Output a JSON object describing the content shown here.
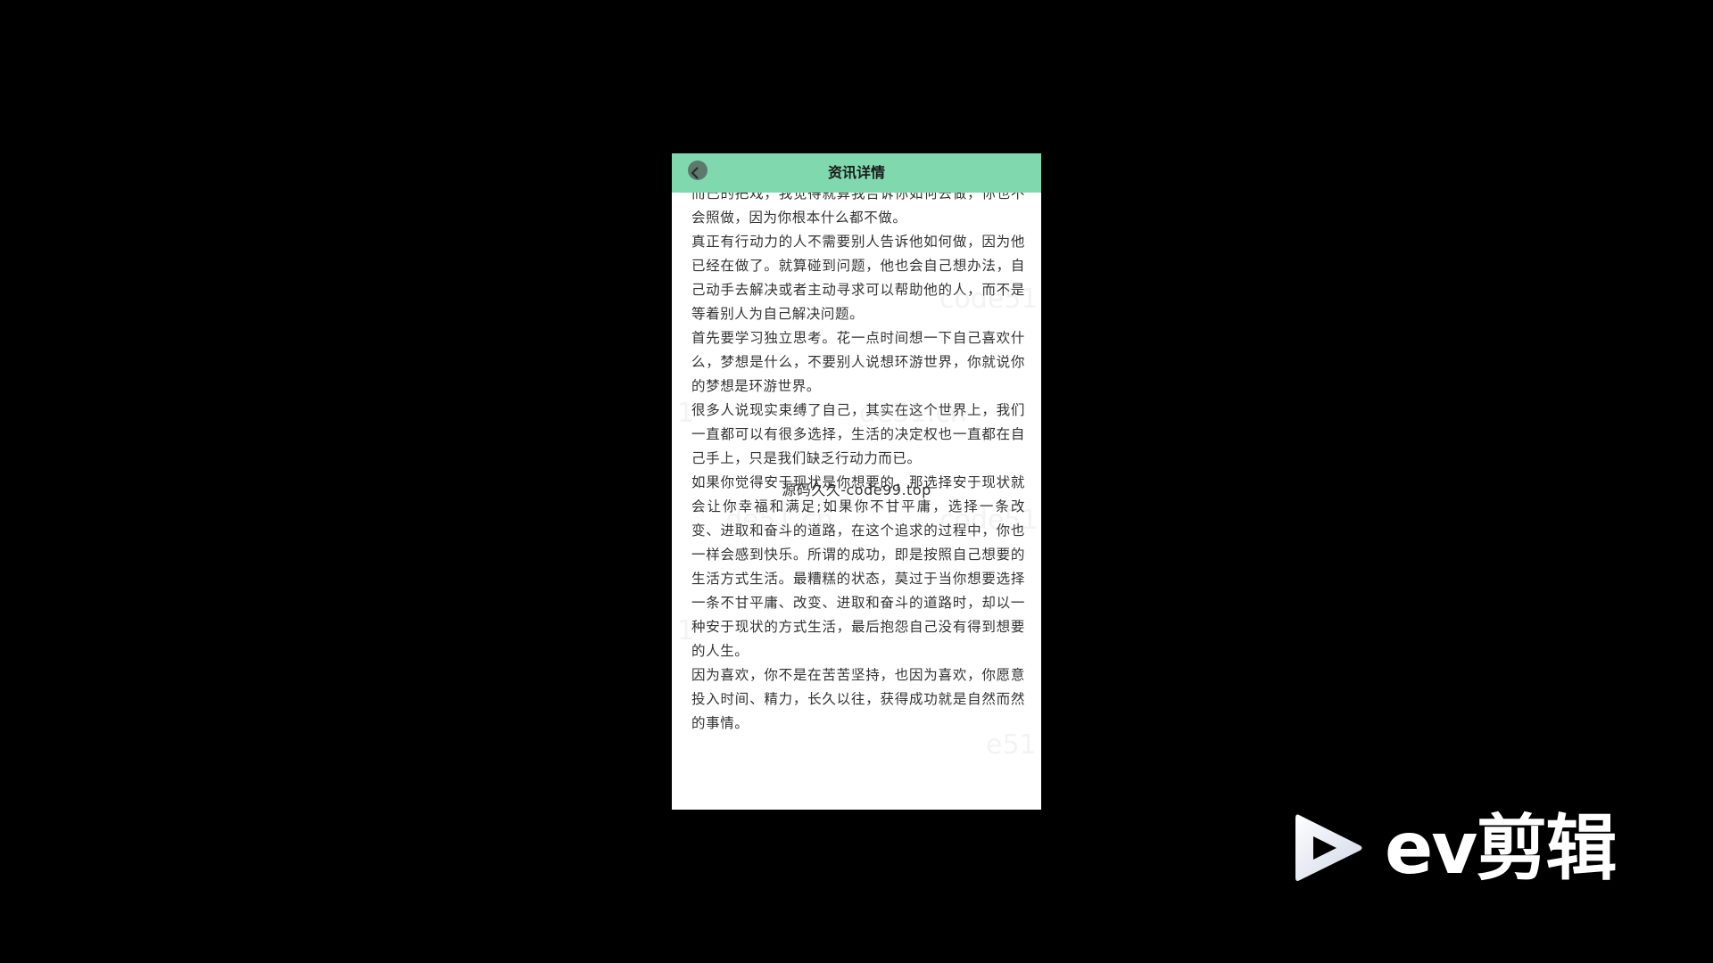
{
  "header": {
    "title": "资讯详情",
    "back_icon": "chevron-left-icon"
  },
  "article": {
    "paragraphs": [
      "而已的把戏，我觉得就算我告诉你如何去做，你也不会照做，因为你根本什么都不做。",
      "真正有行动力的人不需要别人告诉他如何做，因为他已经在做了。就算碰到问题，他也会自己想办法，自己动手去解决或者主动寻求可以帮助他的人，而不是等着别人为自己解决问题。",
      "首先要学习独立思考。花一点时间想一下自己喜欢什么，梦想是什么，不要别人说想环游世界，你就说你的梦想是环游世界。",
      "很多人说现实束缚了自己，其实在这个世界上，我们一直都可以有很多选择，生活的决定权也一直都在自己手上，只是我们缺乏行动力而已。",
      "如果你觉得安于现状是你想要的，那选择安于现状就会让你幸福和满足;如果你不甘平庸，选择一条改变、进取和奋斗的道路，在这个追求的过程中，你也一样会感到快乐。所谓的成功，即是按照自己想要的生活方式生活。最糟糕的状态，莫过于当你想要选择一条不甘平庸、改变、进取和奋斗的道路时，却以一种安于现状的方式生活，最后抱怨自己没有得到想要的人生。",
      "因为喜欢，你不是在苦苦坚持，也因为喜欢，你愿意投入时间、精力，长久以往，获得成功就是自然而然的事情。"
    ]
  },
  "watermarks": {
    "source_text": "源码久久-code99.top",
    "tiles": [
      "1",
      "de51.cn",
      "code51",
      "1",
      "de51.cn",
      "de51.cn",
      "code51",
      "1",
      "e51"
    ]
  },
  "brand": {
    "name": "ev剪辑",
    "icon": "play-icon"
  },
  "colors": {
    "nav_bar": "#80d9ae",
    "background": "#000000",
    "page": "#ffffff",
    "text": "#333333"
  }
}
